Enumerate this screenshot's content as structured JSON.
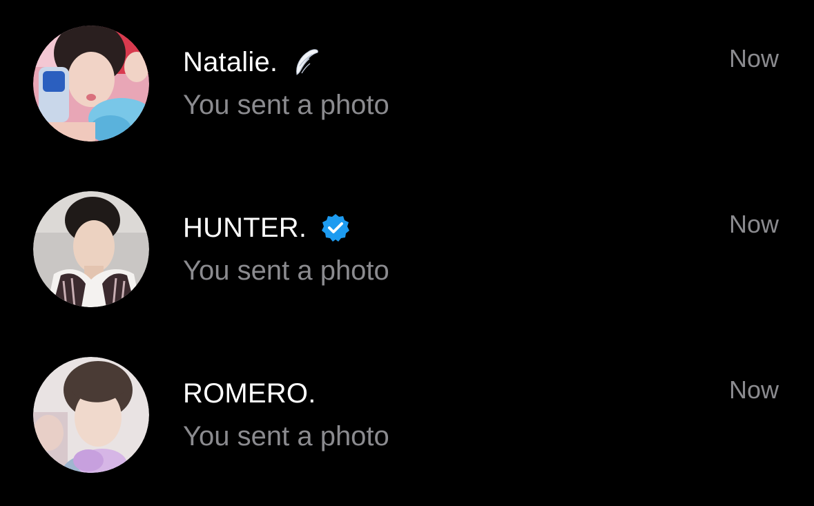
{
  "colors": {
    "background": "#000000",
    "name_text": "#ffffff",
    "secondary_text": "#8b8b8f",
    "verified_badge": "#1d9bf0"
  },
  "conversations": [
    {
      "name": "Natalie.",
      "badge_icon": "angel-wing-icon",
      "preview": "You sent a photo",
      "time": "Now"
    },
    {
      "name": "HUNTER.",
      "badge_icon": "verified-badge-icon",
      "preview": "You sent a photo",
      "time": "Now"
    },
    {
      "name": "ROMERO.",
      "badge_icon": "",
      "preview": "You sent a photo",
      "time": "Now"
    }
  ]
}
